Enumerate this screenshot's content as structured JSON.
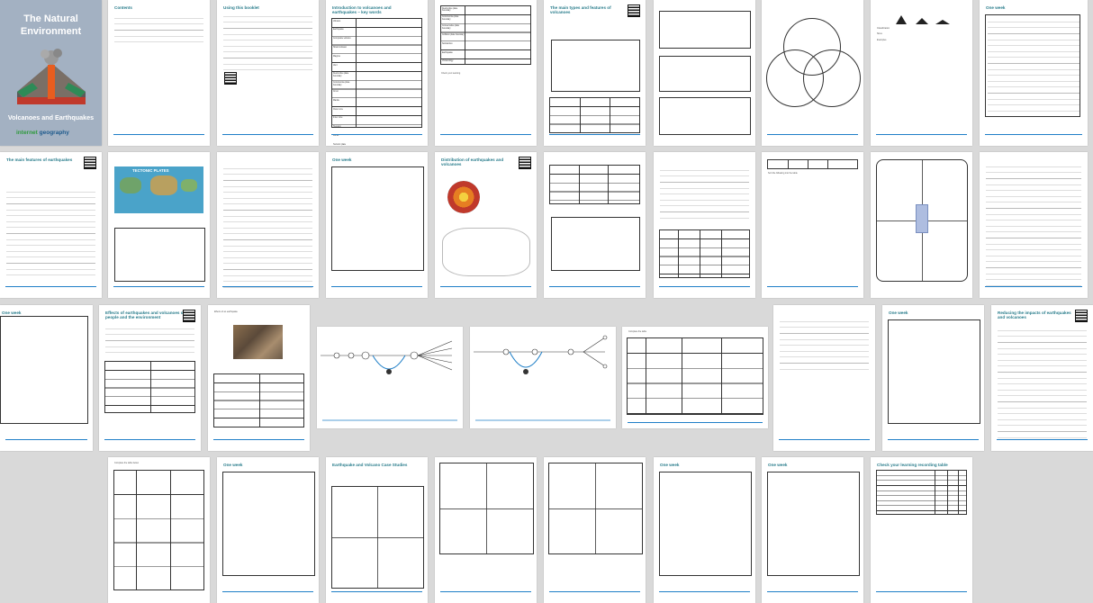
{
  "cover": {
    "title": "The Natural Environment",
    "subtitle": "Volcanoes and Earthquakes",
    "brand_prefix": "internet",
    "brand_suffix": "geography"
  },
  "pages": {
    "contents": "Contents",
    "using": "Using this booklet",
    "intro": "Introduction to volcanoes and earthquakes – key words",
    "types": "The main types and features of volcanoes",
    "quakes": "The main features of earthquakes",
    "tectonic": "TECTONIC PLATES",
    "distribution": "Distribution of earthquakes and volcanoes",
    "effects": "Effects of earthquakes and volcanoes on people and the environment",
    "reducing": "Reducing the impacts of earthquakes and volcanoes",
    "casestudy": "Earthquake and Volcano Case Studies",
    "tracking": "Check your learning recording table",
    "one_week": "One week"
  },
  "keywords": [
    "Volcano",
    "Earthquake",
    "Composite volcano",
    "Shield volcano",
    "Magma",
    "Vent",
    "Destructive plate boundary",
    "Constructive plate boundary",
    "Crust",
    "Mantle",
    "Outer core",
    "Inner core",
    "Tsunami",
    "Focus",
    "Tectonic plate"
  ],
  "boundaries": [
    "Destructive plate boundary",
    "Constructive plate boundary",
    "Conservative plate boundary",
    "Collision plate boundary",
    "Subduction",
    "Earthquake",
    "Vulcanology"
  ]
}
